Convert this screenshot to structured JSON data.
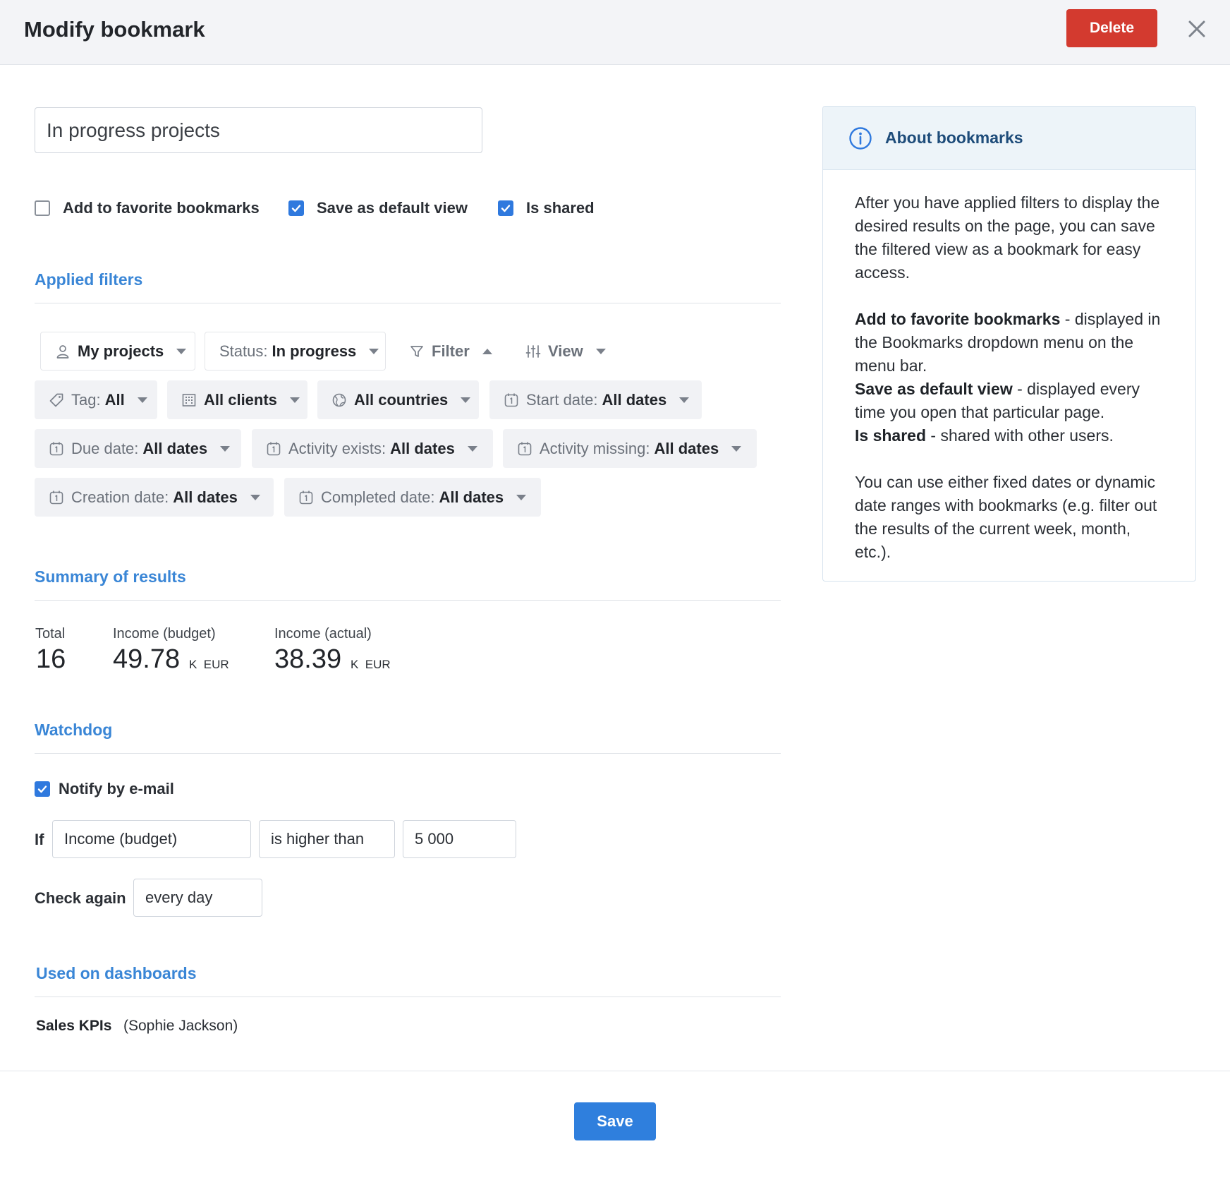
{
  "header": {
    "title": "Modify bookmark",
    "delete_label": "Delete"
  },
  "bookmark": {
    "name": "In progress projects"
  },
  "options": [
    {
      "label": "Add to favorite bookmarks",
      "checked": false
    },
    {
      "label": "Save as default view",
      "checked": true
    },
    {
      "label": "Is shared",
      "checked": true
    }
  ],
  "applied_filters": {
    "title": "Applied filters",
    "row1": [
      {
        "icon": "user-icon",
        "label": "",
        "value": "My projects"
      },
      {
        "icon": "",
        "label": "Status:",
        "value": "In progress"
      },
      {
        "icon": "filter-icon",
        "label": "Filter",
        "value": ""
      },
      {
        "icon": "sliders-icon",
        "label": "View",
        "value": ""
      }
    ],
    "chips": [
      {
        "icon": "tag-icon",
        "label": "Tag:",
        "value": "All"
      },
      {
        "icon": "building-icon",
        "label": "",
        "value": "All clients"
      },
      {
        "icon": "globe-icon",
        "label": "",
        "value": "All countries"
      },
      {
        "icon": "calendar-icon",
        "label": "Start date:",
        "value": "All dates"
      },
      {
        "icon": "calendar-icon",
        "label": "Due date:",
        "value": "All dates"
      },
      {
        "icon": "calendar-icon",
        "label": "Activity exists:",
        "value": "All dates"
      },
      {
        "icon": "calendar-icon",
        "label": "Activity missing:",
        "value": "All dates"
      },
      {
        "icon": "calendar-icon",
        "label": "Creation date:",
        "value": "All dates"
      },
      {
        "icon": "calendar-icon",
        "label": "Completed date:",
        "value": "All dates"
      }
    ]
  },
  "summary": {
    "title": "Summary of results",
    "stats": [
      {
        "label": "Total",
        "value": "16",
        "unit": ""
      },
      {
        "label": "Income (budget)",
        "value": "49.78",
        "unit": "K  EUR"
      },
      {
        "label": "Income (actual)",
        "value": "38.39",
        "unit": "K  EUR"
      }
    ]
  },
  "watchdog": {
    "title": "Watchdog",
    "notify_label": "Notify by e-mail",
    "notify_checked": true,
    "if_label": "If",
    "metric": "Income (budget)",
    "operator": "is higher than",
    "threshold": "5 000",
    "check_again_label": "Check again",
    "frequency": "every day"
  },
  "dashboards": {
    "title": "Used on dashboards",
    "items": [
      {
        "name": "Sales KPIs",
        "owner": "(Sophie Jackson)"
      }
    ]
  },
  "footer": {
    "save_label": "Save"
  },
  "about": {
    "title": "About bookmarks",
    "intro": "After you have applied filters to display the desired results on the page, you can save the filtered view as a bookmark for easy access.",
    "items": [
      {
        "term": "Add to favorite bookmarks",
        "desc": " - displayed in the Bookmarks dropdown menu on the menu bar."
      },
      {
        "term": "Save as default view",
        "desc": " - displayed every time you open that particular page."
      },
      {
        "term": "Is shared",
        "desc": " - shared with other users."
      }
    ],
    "outro": "You can use either fixed dates or dynamic date ranges with bookmarks (e.g. filter out the results of the current week, month, etc.)."
  },
  "colors": {
    "accent": "#2f79de",
    "danger": "#d33a2f",
    "section_title": "#3a86d6"
  }
}
